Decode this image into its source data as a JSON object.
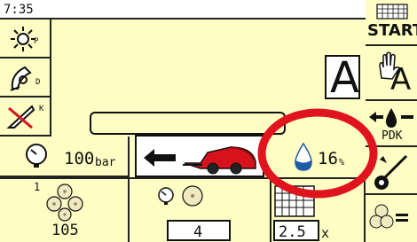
{
  "status": {
    "time": "7:35"
  },
  "left_icons": [
    {
      "icon": "sun-icon",
      "suffix": "P"
    },
    {
      "icon": "pickup-icon",
      "suffix": "D"
    },
    {
      "icon": "knife-crossed-icon",
      "suffix": "K"
    },
    {
      "icon": "pressure-gauge-icon",
      "value": "100",
      "unit": "bar"
    }
  ],
  "main": {
    "mode_letter": "A",
    "message_text": "",
    "moisture_value": "16",
    "moisture_unit": "%"
  },
  "bottom": {
    "bale_counter_index": "1",
    "bale_count": "105",
    "density_value": "4",
    "net_layers_value": "2.5",
    "net_layers_unit": "x"
  },
  "right_menu": {
    "start_label": "START",
    "manual_auto_label": "A",
    "pdk_label": "PDK"
  },
  "colors": {
    "background": "#fdfdc4",
    "baler_red": "#d8121b",
    "moisture_blue": "#1e5ba8",
    "annotation_red": "#e0141c"
  }
}
